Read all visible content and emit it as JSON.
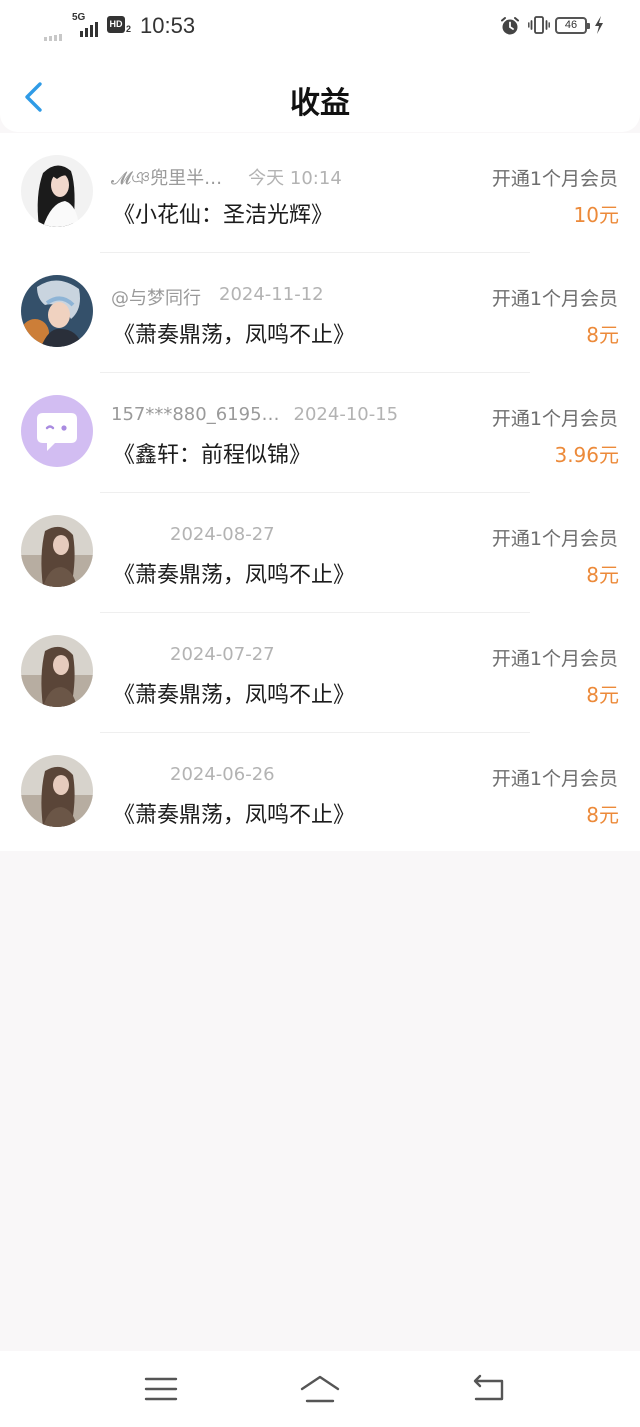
{
  "status_bar": {
    "network": "5G",
    "hd": "HD",
    "hd_sub": "2",
    "time": "10:53",
    "battery": "46",
    "icons": [
      "signal-icon",
      "alarm-icon",
      "vibrate-icon",
      "battery-icon",
      "charging-icon"
    ]
  },
  "header": {
    "title": "收益",
    "back_icon": "chevron-left-icon",
    "accent_color": "#2f9be6"
  },
  "colors": {
    "amount": "#ec8a3a",
    "date": "#b3b3b3",
    "username": "#9a9a9a"
  },
  "records": [
    {
      "user": "𝓜ঞ兜里半…",
      "date": "今天 10:14",
      "book": "《小花仙：圣洁光辉》",
      "type": "开通1个月会员",
      "amount": "10元"
    },
    {
      "user": "@与梦同行",
      "date": "2024-11-12",
      "book": "《萧奏鼎荡，凤鸣不止》",
      "type": "开通1个月会员",
      "amount": "8元"
    },
    {
      "user": "157***880_6195…",
      "date": "2024-10-15",
      "book": "《鑫轩：前程似锦》",
      "type": "开通1个月会员",
      "amount": "3.96元"
    },
    {
      "user": "",
      "date": "2024-08-27",
      "book": "《萧奏鼎荡，凤鸣不止》",
      "type": "开通1个月会员",
      "amount": "8元"
    },
    {
      "user": "",
      "date": "2024-07-27",
      "book": "《萧奏鼎荡，凤鸣不止》",
      "type": "开通1个月会员",
      "amount": "8元"
    },
    {
      "user": "",
      "date": "2024-06-26",
      "book": "《萧奏鼎荡，凤鸣不止》",
      "type": "开通1个月会员",
      "amount": "8元"
    }
  ],
  "nav": {
    "icons": [
      "menu-icon",
      "home-icon",
      "back-icon"
    ]
  }
}
